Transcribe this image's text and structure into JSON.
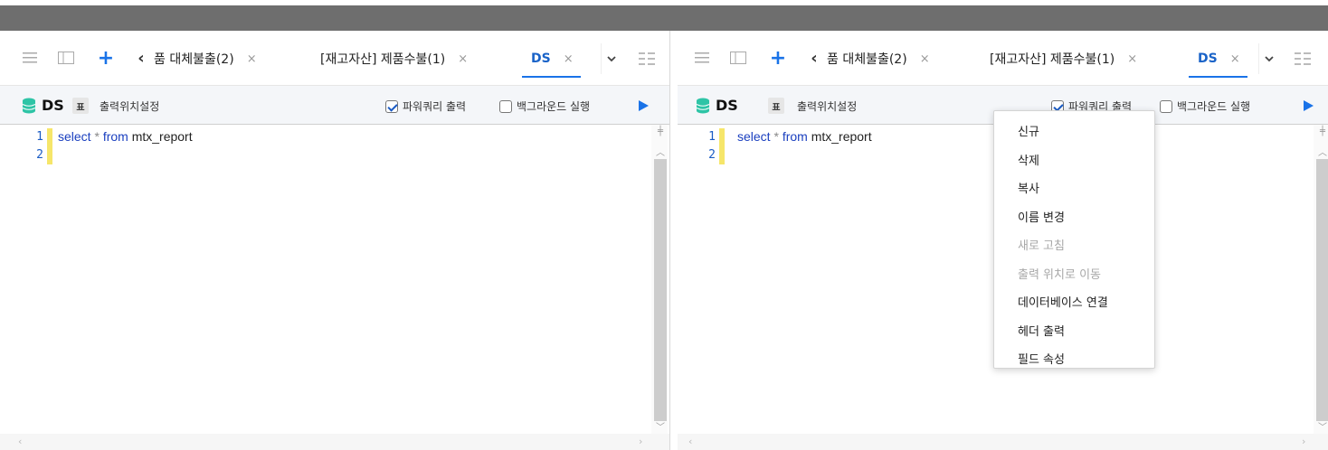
{
  "top_band": {
    "arrow": "ˆ"
  },
  "left": {
    "tabs": [
      {
        "label": "품 대체불출(2)",
        "close": "×"
      },
      {
        "label": "[재고자산] 제품수불(1)",
        "close": "×"
      },
      {
        "label": "DS",
        "close": "×",
        "active": true
      }
    ],
    "toolbar": {
      "ds_label": "DS",
      "table_icon": "표",
      "output_position": "출력위치설정",
      "powerquery_label": "파워쿼리 출력",
      "powerquery_checked": true,
      "background_label": "백그라운드 실행",
      "background_checked": false
    },
    "editor": {
      "line_numbers": [
        "1",
        "2"
      ],
      "code": {
        "kw1": "select",
        "op": " * ",
        "kw2": "from",
        "rest": " mtx_report"
      }
    }
  },
  "right": {
    "tabs": [
      {
        "label": "품 대체불출(2)",
        "close": "×"
      },
      {
        "label": "[재고자산] 제품수불(1)",
        "close": "×"
      },
      {
        "label": "DS",
        "close": "×",
        "active": true
      }
    ],
    "toolbar": {
      "ds_label": "DS",
      "table_icon": "표",
      "output_position": "출력위치설정",
      "powerquery_label": "파워쿼리 출력",
      "powerquery_checked": true,
      "background_label": "백그라운드 실행",
      "background_checked": false
    },
    "editor": {
      "line_numbers": [
        "1",
        "2"
      ],
      "code": {
        "kw1": "select",
        "op": " * ",
        "kw2": "from",
        "rest": " mtx_report"
      }
    }
  },
  "context_menu": {
    "items": [
      {
        "label": "신규",
        "enabled": true
      },
      {
        "label": "삭제",
        "enabled": true
      },
      {
        "label": "복사",
        "enabled": true
      },
      {
        "label": "이름 변경",
        "enabled": true
      },
      {
        "label": "새로 고침",
        "enabled": false
      },
      {
        "label": "출력 위치로 이동",
        "enabled": false
      },
      {
        "label": "데이터베이스 연결",
        "enabled": true
      },
      {
        "label": "헤더 출력",
        "enabled": true
      },
      {
        "label": "필드 속성",
        "enabled": true
      }
    ]
  },
  "icons": {
    "menu": "hamburger-icon",
    "sidebar": "sidebar-panel-icon",
    "add": "plus-icon",
    "scroll_left": "chevron-left-icon",
    "dropdown": "chevron-down-icon",
    "layout": "layout-grid-icon",
    "database": "database-icon",
    "run": "play-icon"
  },
  "colors": {
    "accent": "#1a73e8",
    "db_icon": "#2ec4a6",
    "modified_bar": "#f6e66a",
    "keyword": "#1a3fbf"
  }
}
